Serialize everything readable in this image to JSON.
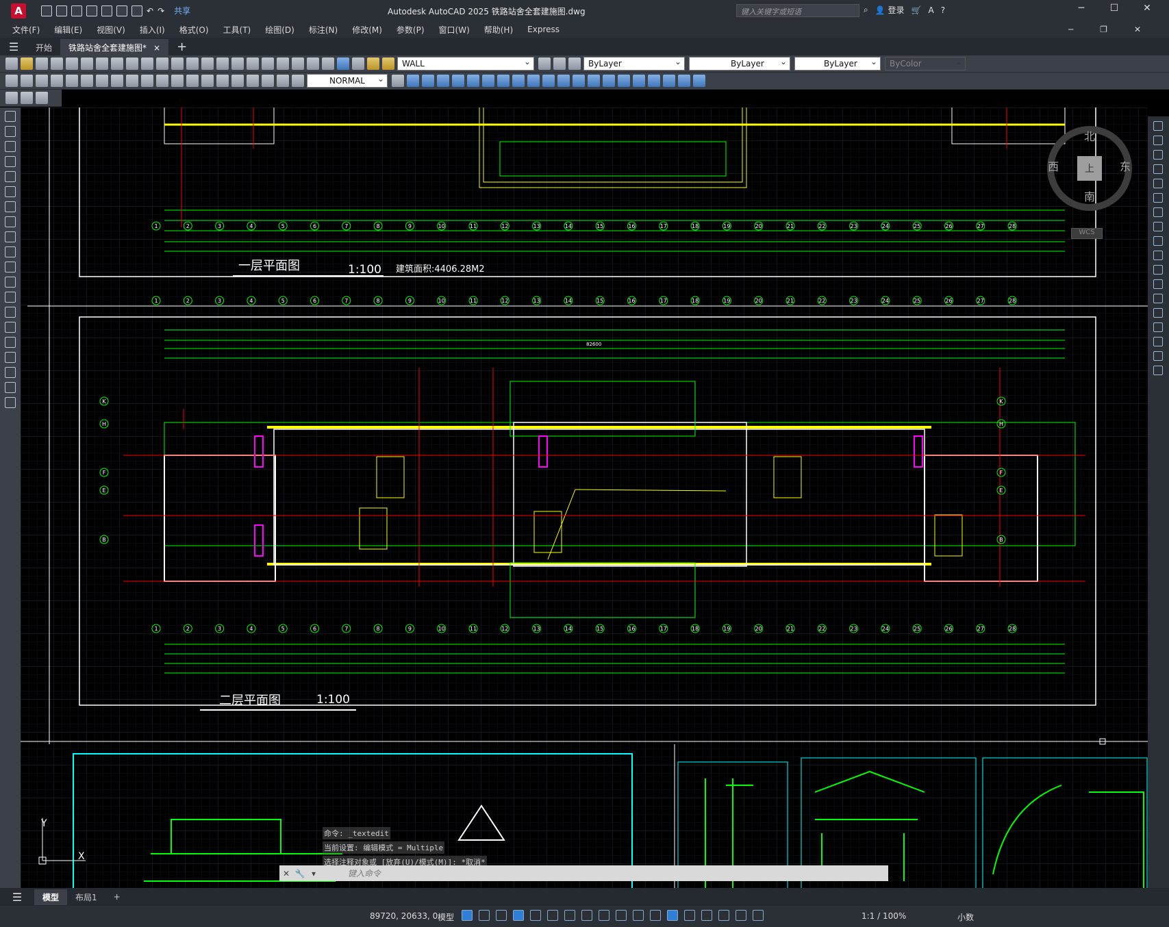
{
  "app": {
    "logo_letter": "A",
    "window_title": "Autodesk AutoCAD 2025    铁路站舍全套建施图.dwg",
    "share_label": "共享",
    "search_placeholder": "键入关键字或短语",
    "signin_label": "登录",
    "help_label": "?"
  },
  "menu": [
    "文件(F)",
    "编辑(E)",
    "视图(V)",
    "插入(I)",
    "格式(O)",
    "工具(T)",
    "绘图(D)",
    "标注(N)",
    "修改(M)",
    "参数(P)",
    "窗口(W)",
    "帮助(H)",
    "Express"
  ],
  "doc_tabs": {
    "start": "开始",
    "active": "铁路站舍全套建施图*",
    "close": "×",
    "add": "+"
  },
  "toolbar": {
    "layer_name": "WALL",
    "color": "ByLayer",
    "linetype": "ByLayer",
    "lineweight": "ByLayer",
    "plotstyle": "ByColor",
    "dimstyle": "NORMAL"
  },
  "drawing": {
    "plan1_title": "一层平面图",
    "plan1_scale": "1:100",
    "plan1_area": "建筑面积:4406.28M2",
    "plan2_title": "二层平面图",
    "plan2_scale": "1:100",
    "axis_numbers": [
      "1",
      "2",
      "3",
      "4",
      "5",
      "6",
      "7",
      "8",
      "9",
      "10",
      "11",
      "12",
      "13",
      "14",
      "15",
      "16",
      "17",
      "18",
      "19",
      "20",
      "21",
      "22",
      "23",
      "24",
      "25",
      "26",
      "27",
      "28"
    ],
    "row_letters_left": [
      "K",
      "H",
      "F",
      "E",
      "B"
    ],
    "overall_dim": "82600"
  },
  "viewcube": {
    "north": "北",
    "south": "南",
    "east": "东",
    "west": "西",
    "top": "上",
    "wcs": "WCS"
  },
  "ucs": {
    "x": "X",
    "y": "Y"
  },
  "command_history": [
    "命令: _textedit",
    "当前设置: 编辑模式 = Multiple",
    "选择注释对象或 [放弃(U)/模式(M)]: *取消*"
  ],
  "command_placeholder": "键入命令",
  "layout_tabs": {
    "model": "模型",
    "layout1": "布局1",
    "add": "+"
  },
  "status": {
    "coords": "89720, 20633, 0",
    "space": "模型",
    "annotation_scale": "1:1 / 100%",
    "units": "小数"
  },
  "colors": {
    "grid_green": "#00ff00",
    "wall_yellow": "#ffff00",
    "axis_red": "#ff0000",
    "frame_white": "#ffffff",
    "cyan": "#00ffff",
    "magenta": "#ff00ff"
  }
}
